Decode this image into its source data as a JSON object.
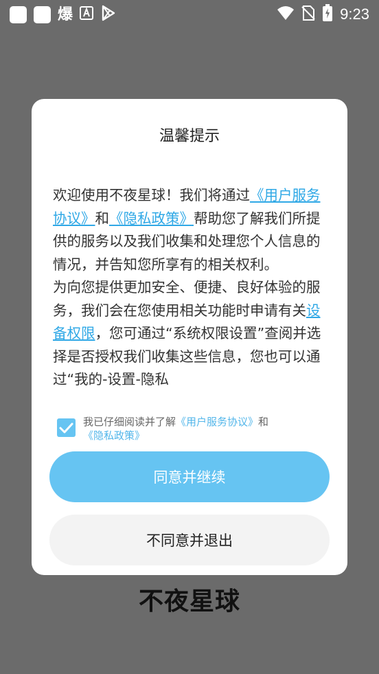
{
  "status_bar": {
    "time": "9:23",
    "left_glyph": "爆"
  },
  "dialog": {
    "title": "温馨提示",
    "p1": {
      "t1": "欢迎使用不夜星球！我们将通过",
      "link1": "《用户服务协议》",
      "t2": "和",
      "link2": "《隐私政策》",
      "t3": "帮助您了解我们所提供的服务以及我们收集和处理您个人信息的情况，并告知您所享有的相关权利。"
    },
    "p2": {
      "t1": "为向您提供更加安全、便捷、良好体验的服务，我们会在您使用相关功能时申请有关",
      "link": "设备权限",
      "t2": "，您可通过“系统权限设置”查阅并选择是否授权我们收集这些信息，您也可以通过“我的-设置-隐私"
    },
    "consent": {
      "t1": "我已仔细阅读并了解",
      "link1": "《用户服务协议》",
      "t2": "和",
      "link2": "《隐私政策》"
    },
    "agree_button": "同意并继续",
    "disagree_button": "不同意并退出"
  },
  "brand": "不夜星球",
  "colors": {
    "overlay": "#6b6b6b",
    "accent": "#66c4f2",
    "link": "#2fa8e6"
  }
}
